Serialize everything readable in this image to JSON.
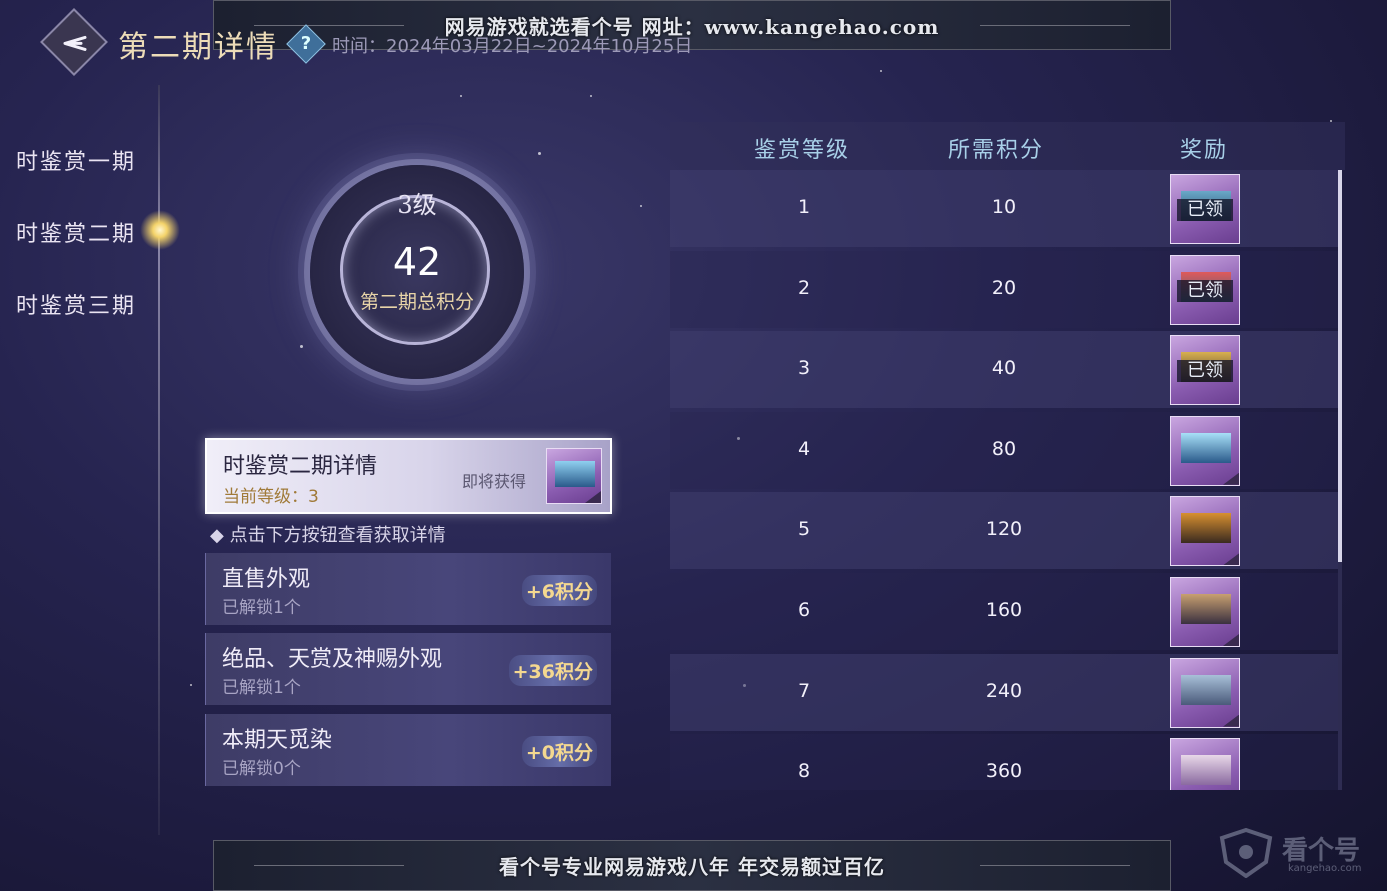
{
  "banner": {
    "top_text": "网易游戏就选看个号  网址：www.kangehao.com",
    "bottom_text": "看个号专业网易游戏八年  年交易额过百亿"
  },
  "header": {
    "title": "第二期详情",
    "help_symbol": "?",
    "time_text": "时间：2024年03月22日~2024年10月25日"
  },
  "sidebar": {
    "items": [
      {
        "label": "时鉴赏一期",
        "active": false
      },
      {
        "label": "时鉴赏二期",
        "active": true
      },
      {
        "label": "时鉴赏三期",
        "active": false
      }
    ]
  },
  "orb": {
    "level": "3级",
    "score": "42",
    "label": "第二期总积分"
  },
  "detail": {
    "title": "时鉴赏二期详情",
    "current_level": "当前等级：3",
    "soon_text": "即将获得"
  },
  "hint": "◆ 点击下方按钮查看获取详情",
  "unlocks": [
    {
      "name": "直售外观",
      "status": "已解锁1个",
      "points": "+6积分"
    },
    {
      "name": "绝品、天赏及神赐外观",
      "status": "已解锁1个",
      "points": "+36积分"
    },
    {
      "name": "本期天觅染",
      "status": "已解锁0个",
      "points": "+0积分"
    }
  ],
  "table": {
    "headers": {
      "level": "鉴赏等级",
      "points": "所需积分",
      "reward": "奖励"
    },
    "claimed_label": "已领",
    "rows": [
      {
        "level": "1",
        "points": "10",
        "claimed": true
      },
      {
        "level": "2",
        "points": "20",
        "claimed": true
      },
      {
        "level": "3",
        "points": "40",
        "claimed": true
      },
      {
        "level": "4",
        "points": "80",
        "claimed": false
      },
      {
        "level": "5",
        "points": "120",
        "claimed": false
      },
      {
        "level": "6",
        "points": "160",
        "claimed": false
      },
      {
        "level": "7",
        "points": "240",
        "claimed": false
      },
      {
        "level": "8",
        "points": "360",
        "claimed": false
      }
    ]
  },
  "watermark": {
    "text": "看个号",
    "sub": "kangehao.com"
  },
  "colors": {
    "accent_gold": "#eddcb8",
    "header_blue": "#a8d0e8",
    "points_gold": "#f4d890"
  }
}
